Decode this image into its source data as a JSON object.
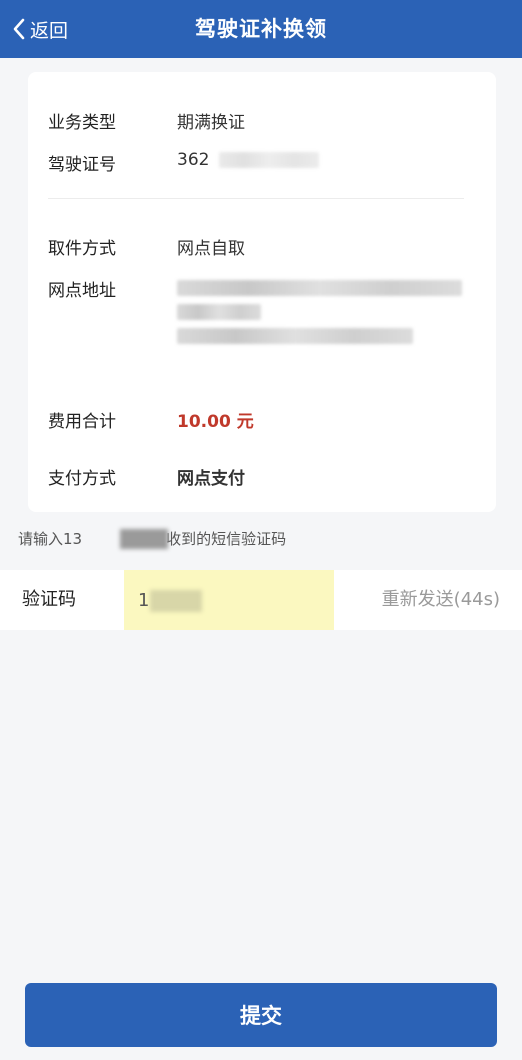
{
  "header": {
    "back_label": "返回",
    "title": "驾驶证补换领"
  },
  "details": {
    "business_type_label": "业务类型",
    "business_type_value": "期满换证",
    "license_no_label": "驾驶证号",
    "license_no_value": "362",
    "pickup_label": "取件方式",
    "pickup_value": "网点自取",
    "branch_address_label": "网点地址",
    "fee_label": "费用合计",
    "fee_value": "10.00 元",
    "payment_label": "支付方式",
    "payment_value": "网点支付"
  },
  "sms_hint": {
    "prefix": "请输入13",
    "suffix": "收到的短信验证码"
  },
  "verification": {
    "label": "验证码",
    "input_value": "1",
    "resend_label": "重新发送(44s)"
  },
  "submit_label": "提交",
  "colors": {
    "primary": "#2b62b6",
    "fee": "#c0392b",
    "input_highlight": "#fbf8c0"
  }
}
